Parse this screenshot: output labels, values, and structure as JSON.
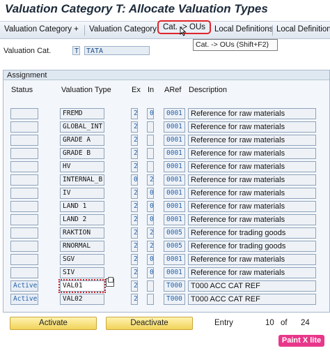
{
  "title": "Valuation Category T: Allocate Valuation Types",
  "toolbar": {
    "items": [
      "Valuation Category +",
      "Valuation Category -",
      "Cat. -> OUs",
      "Local Definitions",
      "Local Definitions"
    ]
  },
  "tooltip": "Cat. -> OUs    (Shift+F2)",
  "header": {
    "valuation_cat_label": "Valuation Cat.",
    "valuation_cat_value": "T",
    "valuation_cat_desc": "TATA"
  },
  "assignment": {
    "group_title": "Assignment",
    "columns": [
      "Status",
      "Valuation Type",
      "Ex",
      "In",
      "ARef",
      "Description"
    ],
    "rows": [
      {
        "status": "",
        "type": "FREMD",
        "ex": "2",
        "in": "0",
        "aref": "0001",
        "desc": "Reference for raw materials"
      },
      {
        "status": "",
        "type": "GLOBAL_INT",
        "ex": "2",
        "in": "",
        "aref": "0001",
        "desc": "Reference for raw materials"
      },
      {
        "status": "",
        "type": "GRADE A",
        "ex": "2",
        "in": "",
        "aref": "0001",
        "desc": "Reference for raw materials"
      },
      {
        "status": "",
        "type": "GRADE B",
        "ex": "2",
        "in": "",
        "aref": "0001",
        "desc": "Reference for raw materials"
      },
      {
        "status": "",
        "type": "HV",
        "ex": "2",
        "in": "",
        "aref": "0001",
        "desc": "Reference for raw materials"
      },
      {
        "status": "",
        "type": "INTERNAL_B",
        "ex": "0",
        "in": "2",
        "aref": "0001",
        "desc": "Reference for raw materials"
      },
      {
        "status": "",
        "type": "IV",
        "ex": "2",
        "in": "0",
        "aref": "0001",
        "desc": "Reference for raw materials"
      },
      {
        "status": "",
        "type": "LAND 1",
        "ex": "2",
        "in": "0",
        "aref": "0001",
        "desc": "Reference for raw materials"
      },
      {
        "status": "",
        "type": "LAND 2",
        "ex": "2",
        "in": "0",
        "aref": "0001",
        "desc": "Reference for raw materials"
      },
      {
        "status": "",
        "type": "RAKTION",
        "ex": "2",
        "in": "2",
        "aref": "0005",
        "desc": "Reference for trading goods"
      },
      {
        "status": "",
        "type": "RNORMAL",
        "ex": "2",
        "in": "2",
        "aref": "0005",
        "desc": "Reference for trading goods"
      },
      {
        "status": "",
        "type": "SGV",
        "ex": "2",
        "in": "0",
        "aref": "0001",
        "desc": "Reference for raw materials"
      },
      {
        "status": "",
        "type": "SIV",
        "ex": "2",
        "in": "0",
        "aref": "0001",
        "desc": "Reference for raw materials"
      },
      {
        "status": "Active",
        "type": "VAL01",
        "ex": "2",
        "in": "",
        "aref": "T000",
        "desc": "T000 ACC CAT REF"
      },
      {
        "status": "Active",
        "type": "VAL02",
        "ex": "2",
        "in": "",
        "aref": "T000",
        "desc": "T000 ACC CAT REF"
      }
    ]
  },
  "footer": {
    "activate_label": "Activate",
    "deactivate_label": "Deactivate",
    "entry_label": "Entry",
    "entry_current": "10",
    "entry_of": "of",
    "entry_total": "24"
  },
  "watermark": "Paint X lite",
  "colors": {
    "highlight_border": "#e0242a",
    "button_yellow": "#f1d35a",
    "link_blue": "#2460a8"
  }
}
